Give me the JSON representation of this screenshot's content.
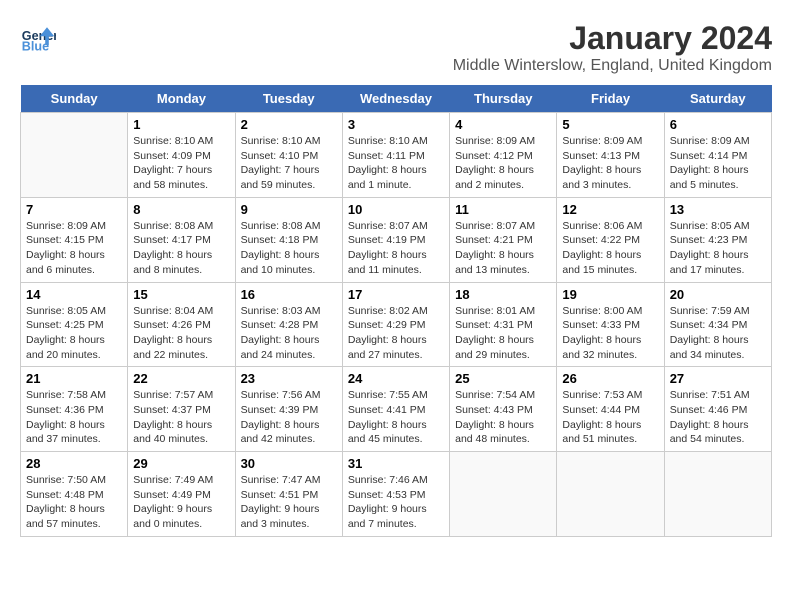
{
  "header": {
    "logo_line1": "General",
    "logo_line2": "Blue",
    "title": "January 2024",
    "subtitle": "Middle Winterslow, England, United Kingdom"
  },
  "days_of_week": [
    "Sunday",
    "Monday",
    "Tuesday",
    "Wednesday",
    "Thursday",
    "Friday",
    "Saturday"
  ],
  "weeks": [
    [
      {
        "day": "",
        "info": ""
      },
      {
        "day": "1",
        "info": "Sunrise: 8:10 AM\nSunset: 4:09 PM\nDaylight: 7 hours\nand 58 minutes."
      },
      {
        "day": "2",
        "info": "Sunrise: 8:10 AM\nSunset: 4:10 PM\nDaylight: 7 hours\nand 59 minutes."
      },
      {
        "day": "3",
        "info": "Sunrise: 8:10 AM\nSunset: 4:11 PM\nDaylight: 8 hours\nand 1 minute."
      },
      {
        "day": "4",
        "info": "Sunrise: 8:09 AM\nSunset: 4:12 PM\nDaylight: 8 hours\nand 2 minutes."
      },
      {
        "day": "5",
        "info": "Sunrise: 8:09 AM\nSunset: 4:13 PM\nDaylight: 8 hours\nand 3 minutes."
      },
      {
        "day": "6",
        "info": "Sunrise: 8:09 AM\nSunset: 4:14 PM\nDaylight: 8 hours\nand 5 minutes."
      }
    ],
    [
      {
        "day": "7",
        "info": "Sunrise: 8:09 AM\nSunset: 4:15 PM\nDaylight: 8 hours\nand 6 minutes."
      },
      {
        "day": "8",
        "info": "Sunrise: 8:08 AM\nSunset: 4:17 PM\nDaylight: 8 hours\nand 8 minutes."
      },
      {
        "day": "9",
        "info": "Sunrise: 8:08 AM\nSunset: 4:18 PM\nDaylight: 8 hours\nand 10 minutes."
      },
      {
        "day": "10",
        "info": "Sunrise: 8:07 AM\nSunset: 4:19 PM\nDaylight: 8 hours\nand 11 minutes."
      },
      {
        "day": "11",
        "info": "Sunrise: 8:07 AM\nSunset: 4:21 PM\nDaylight: 8 hours\nand 13 minutes."
      },
      {
        "day": "12",
        "info": "Sunrise: 8:06 AM\nSunset: 4:22 PM\nDaylight: 8 hours\nand 15 minutes."
      },
      {
        "day": "13",
        "info": "Sunrise: 8:05 AM\nSunset: 4:23 PM\nDaylight: 8 hours\nand 17 minutes."
      }
    ],
    [
      {
        "day": "14",
        "info": "Sunrise: 8:05 AM\nSunset: 4:25 PM\nDaylight: 8 hours\nand 20 minutes."
      },
      {
        "day": "15",
        "info": "Sunrise: 8:04 AM\nSunset: 4:26 PM\nDaylight: 8 hours\nand 22 minutes."
      },
      {
        "day": "16",
        "info": "Sunrise: 8:03 AM\nSunset: 4:28 PM\nDaylight: 8 hours\nand 24 minutes."
      },
      {
        "day": "17",
        "info": "Sunrise: 8:02 AM\nSunset: 4:29 PM\nDaylight: 8 hours\nand 27 minutes."
      },
      {
        "day": "18",
        "info": "Sunrise: 8:01 AM\nSunset: 4:31 PM\nDaylight: 8 hours\nand 29 minutes."
      },
      {
        "day": "19",
        "info": "Sunrise: 8:00 AM\nSunset: 4:33 PM\nDaylight: 8 hours\nand 32 minutes."
      },
      {
        "day": "20",
        "info": "Sunrise: 7:59 AM\nSunset: 4:34 PM\nDaylight: 8 hours\nand 34 minutes."
      }
    ],
    [
      {
        "day": "21",
        "info": "Sunrise: 7:58 AM\nSunset: 4:36 PM\nDaylight: 8 hours\nand 37 minutes."
      },
      {
        "day": "22",
        "info": "Sunrise: 7:57 AM\nSunset: 4:37 PM\nDaylight: 8 hours\nand 40 minutes."
      },
      {
        "day": "23",
        "info": "Sunrise: 7:56 AM\nSunset: 4:39 PM\nDaylight: 8 hours\nand 42 minutes."
      },
      {
        "day": "24",
        "info": "Sunrise: 7:55 AM\nSunset: 4:41 PM\nDaylight: 8 hours\nand 45 minutes."
      },
      {
        "day": "25",
        "info": "Sunrise: 7:54 AM\nSunset: 4:43 PM\nDaylight: 8 hours\nand 48 minutes."
      },
      {
        "day": "26",
        "info": "Sunrise: 7:53 AM\nSunset: 4:44 PM\nDaylight: 8 hours\nand 51 minutes."
      },
      {
        "day": "27",
        "info": "Sunrise: 7:51 AM\nSunset: 4:46 PM\nDaylight: 8 hours\nand 54 minutes."
      }
    ],
    [
      {
        "day": "28",
        "info": "Sunrise: 7:50 AM\nSunset: 4:48 PM\nDaylight: 8 hours\nand 57 minutes."
      },
      {
        "day": "29",
        "info": "Sunrise: 7:49 AM\nSunset: 4:49 PM\nDaylight: 9 hours\nand 0 minutes."
      },
      {
        "day": "30",
        "info": "Sunrise: 7:47 AM\nSunset: 4:51 PM\nDaylight: 9 hours\nand 3 minutes."
      },
      {
        "day": "31",
        "info": "Sunrise: 7:46 AM\nSunset: 4:53 PM\nDaylight: 9 hours\nand 7 minutes."
      },
      {
        "day": "",
        "info": ""
      },
      {
        "day": "",
        "info": ""
      },
      {
        "day": "",
        "info": ""
      }
    ]
  ]
}
